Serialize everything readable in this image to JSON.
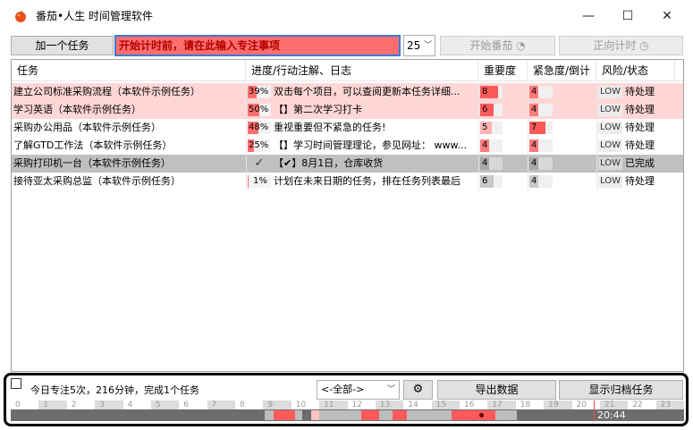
{
  "window": {
    "title": "番茄•人生 时间管理软件",
    "min_icon": "minimize-icon",
    "max_icon": "maximize-icon",
    "close_icon": "close-icon"
  },
  "toolbar": {
    "add_task_label": "加一个任务",
    "focus_placeholder": "开始计时前，请在此输入专注事项",
    "minutes_value": "25",
    "start_label": "开始番茄",
    "forward_label": "正向计时"
  },
  "table": {
    "headers": [
      "任务",
      "进度/行动注解、日志",
      "重要度",
      "紧急度/倒计",
      "风险/状态"
    ],
    "rows": [
      {
        "task": "建立公司标准采购流程（本软件示例任务）",
        "progress": "39%",
        "progress_value": 0.39,
        "note": "双击每个项目，可以查阅更新本任务详细...",
        "importance": "8",
        "urgency": "4",
        "risk": "LOW",
        "status": "待处理",
        "style": "pink"
      },
      {
        "task": "学习英语（本软件示例任务）",
        "progress": "50%",
        "progress_value": 0.5,
        "note": "【】第二次学习打卡",
        "importance": "6",
        "urgency": "4",
        "risk": "LOW",
        "status": "待处理",
        "style": "pink"
      },
      {
        "task": "采购办公用品（本软件示例任务）",
        "progress": "48%",
        "progress_value": 0.48,
        "note": "重视重要但不紧急的任务!",
        "importance": "5",
        "urgency": "7",
        "risk": "LOW",
        "status": "待处理",
        "style": "white"
      },
      {
        "task": "了解GTD工作法（本软件示例任务）",
        "progress": "25%",
        "progress_value": 0.25,
        "note": "【】学习时间管理理论，参见网址：  www...",
        "importance": "4",
        "urgency": "4",
        "risk": "LOW",
        "status": "待处理",
        "style": "white"
      },
      {
        "task": "采购打印机一台（本软件示例任务）",
        "progress": "✓",
        "progress_value": 1.0,
        "note": "【✔】8月1日，仓库收货",
        "importance": "4",
        "urgency": "4",
        "risk": "LOW",
        "status": "已完成",
        "style": "done"
      },
      {
        "task": "接待亚太采购总监（本软件示例任务）",
        "progress": "1%",
        "progress_value": 0.01,
        "note": "计划在未来日期的任务，排在任务列表最后",
        "importance": "6",
        "urgency": "4",
        "risk": "LOW",
        "status": "待处理",
        "style": "white"
      }
    ]
  },
  "status": {
    "summary": "今日专注5次，216分钟，完成1个任务",
    "filter_value": "<-全部->",
    "settings_icon": "gear-icon",
    "export_label": "导出数据",
    "archive_label": "显示归档任务"
  },
  "timeline": {
    "hours": [
      "0",
      "1",
      "2",
      "3",
      "4",
      "5",
      "6",
      "7",
      "8",
      "9",
      "10",
      "11",
      "12",
      "13",
      "14",
      "15",
      "16",
      "17",
      "18",
      "19",
      "20",
      "21",
      "22",
      "23"
    ],
    "current_time": "20:44"
  },
  "colors": {
    "accent_red": "#ff6e6e",
    "pink_row": "#ffd6d6",
    "done_row": "#c0c0c0",
    "selection_border": "#3a7bd5"
  }
}
